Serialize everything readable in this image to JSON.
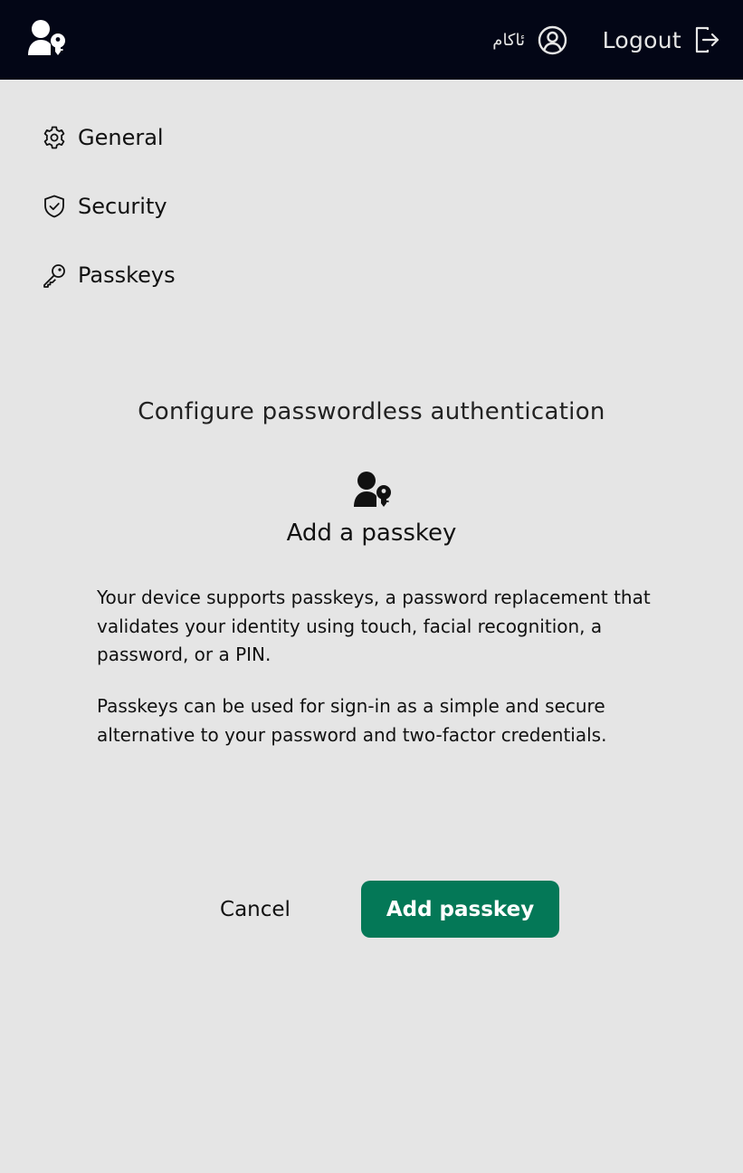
{
  "header": {
    "logo_icon": "user-key-icon",
    "user_name": "ئاکام",
    "user_icon": "user-circle-icon",
    "logout_label": "Logout",
    "logout_icon": "logout-icon",
    "background": "#030616"
  },
  "sidebar": {
    "items": [
      {
        "label": "General",
        "icon": "gear-icon"
      },
      {
        "label": "Security",
        "icon": "shield-check-icon"
      },
      {
        "label": "Passkeys",
        "icon": "key-icon"
      }
    ]
  },
  "main": {
    "title": "Configure passwordless authentication",
    "icon": "user-key-icon",
    "heading": "Add a passkey",
    "paragraphs": [
      "Your device supports passkeys, a password replacement that validates your identity using touch, facial recognition, a password, or a PIN.",
      "Passkeys can be used for sign-in as a simple and secure alternative to your password and two-factor credentials."
    ]
  },
  "actions": {
    "cancel_label": "Cancel",
    "add_label": "Add passkey",
    "accent_color": "#047857"
  }
}
